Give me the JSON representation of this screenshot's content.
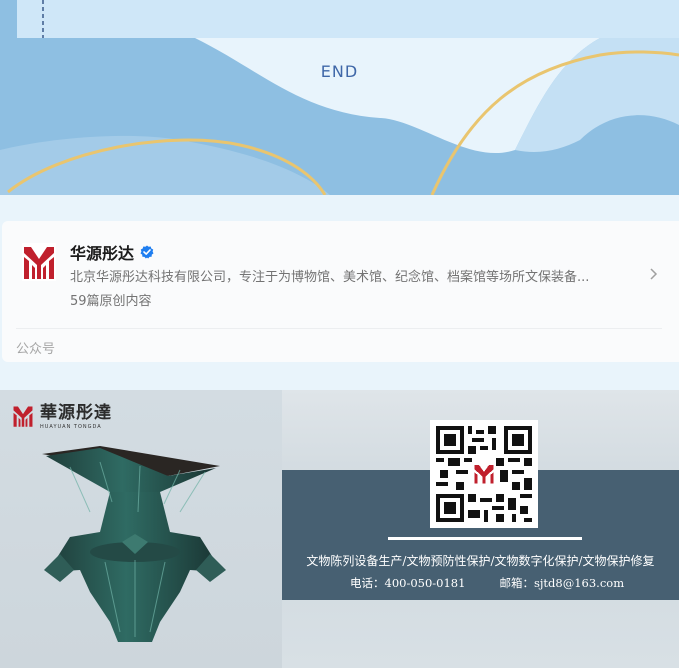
{
  "end_banner": {
    "text": "END"
  },
  "account_card": {
    "name": "华源彤达",
    "description": "北京华源彤达科技有限公司，专注于为博物馆、美术馆、纪念馆、档案馆等场所文保装备...",
    "article_count": "59篇原创内容",
    "footer_label": "公众号"
  },
  "promo": {
    "brand_cn": "華源彤達",
    "brand_en": "HUAYUAN TONGDA",
    "services": "文物陈列设备生产/文物预防性保护/文物数字化保护/文物保护修复",
    "phone": "电话：400-050-0181",
    "email": "邮箱：sjtd8@163.com"
  },
  "colors": {
    "brand_red": "#c0202d",
    "verified_blue": "#1f7ef0",
    "banner_blue": "#8ebfe2",
    "banner_gold": "#e9c56f",
    "band": "#476072"
  }
}
